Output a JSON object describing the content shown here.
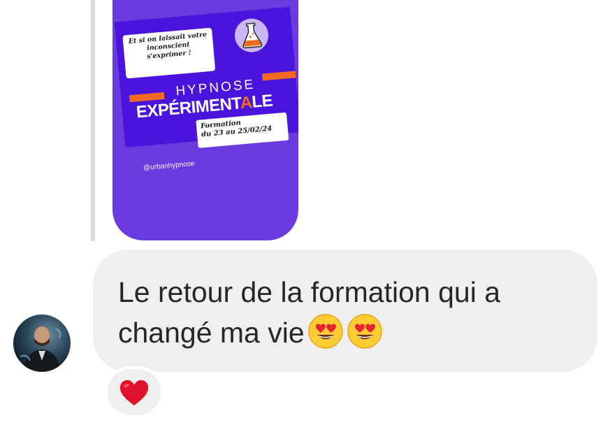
{
  "story": {
    "note_top_lines": [
      "Et si on laissait votre",
      "inconscient",
      "s'exprimer !"
    ],
    "title_line1": "HYPNOSE",
    "title_line2_a": "EXPÉRIMENT",
    "title_line2_b": "A",
    "title_line2_c": "LE",
    "note_bottom_lines": [
      "Formation",
      "du 23 au 25/02/24"
    ],
    "handle": "@urbanhypnose",
    "accent_color": "#f26a21",
    "bg_color": "#4b14dc",
    "icon": "flask-icon"
  },
  "message": {
    "line1": "Le retour de la formation qui a",
    "line2": "changé ma vie",
    "emojis": [
      "heart-eyes-emoji",
      "heart-eyes-emoji"
    ]
  },
  "reaction": {
    "icon": "red-heart-icon",
    "color": "#e0112b"
  },
  "sender": {
    "avatar": "avatar"
  }
}
